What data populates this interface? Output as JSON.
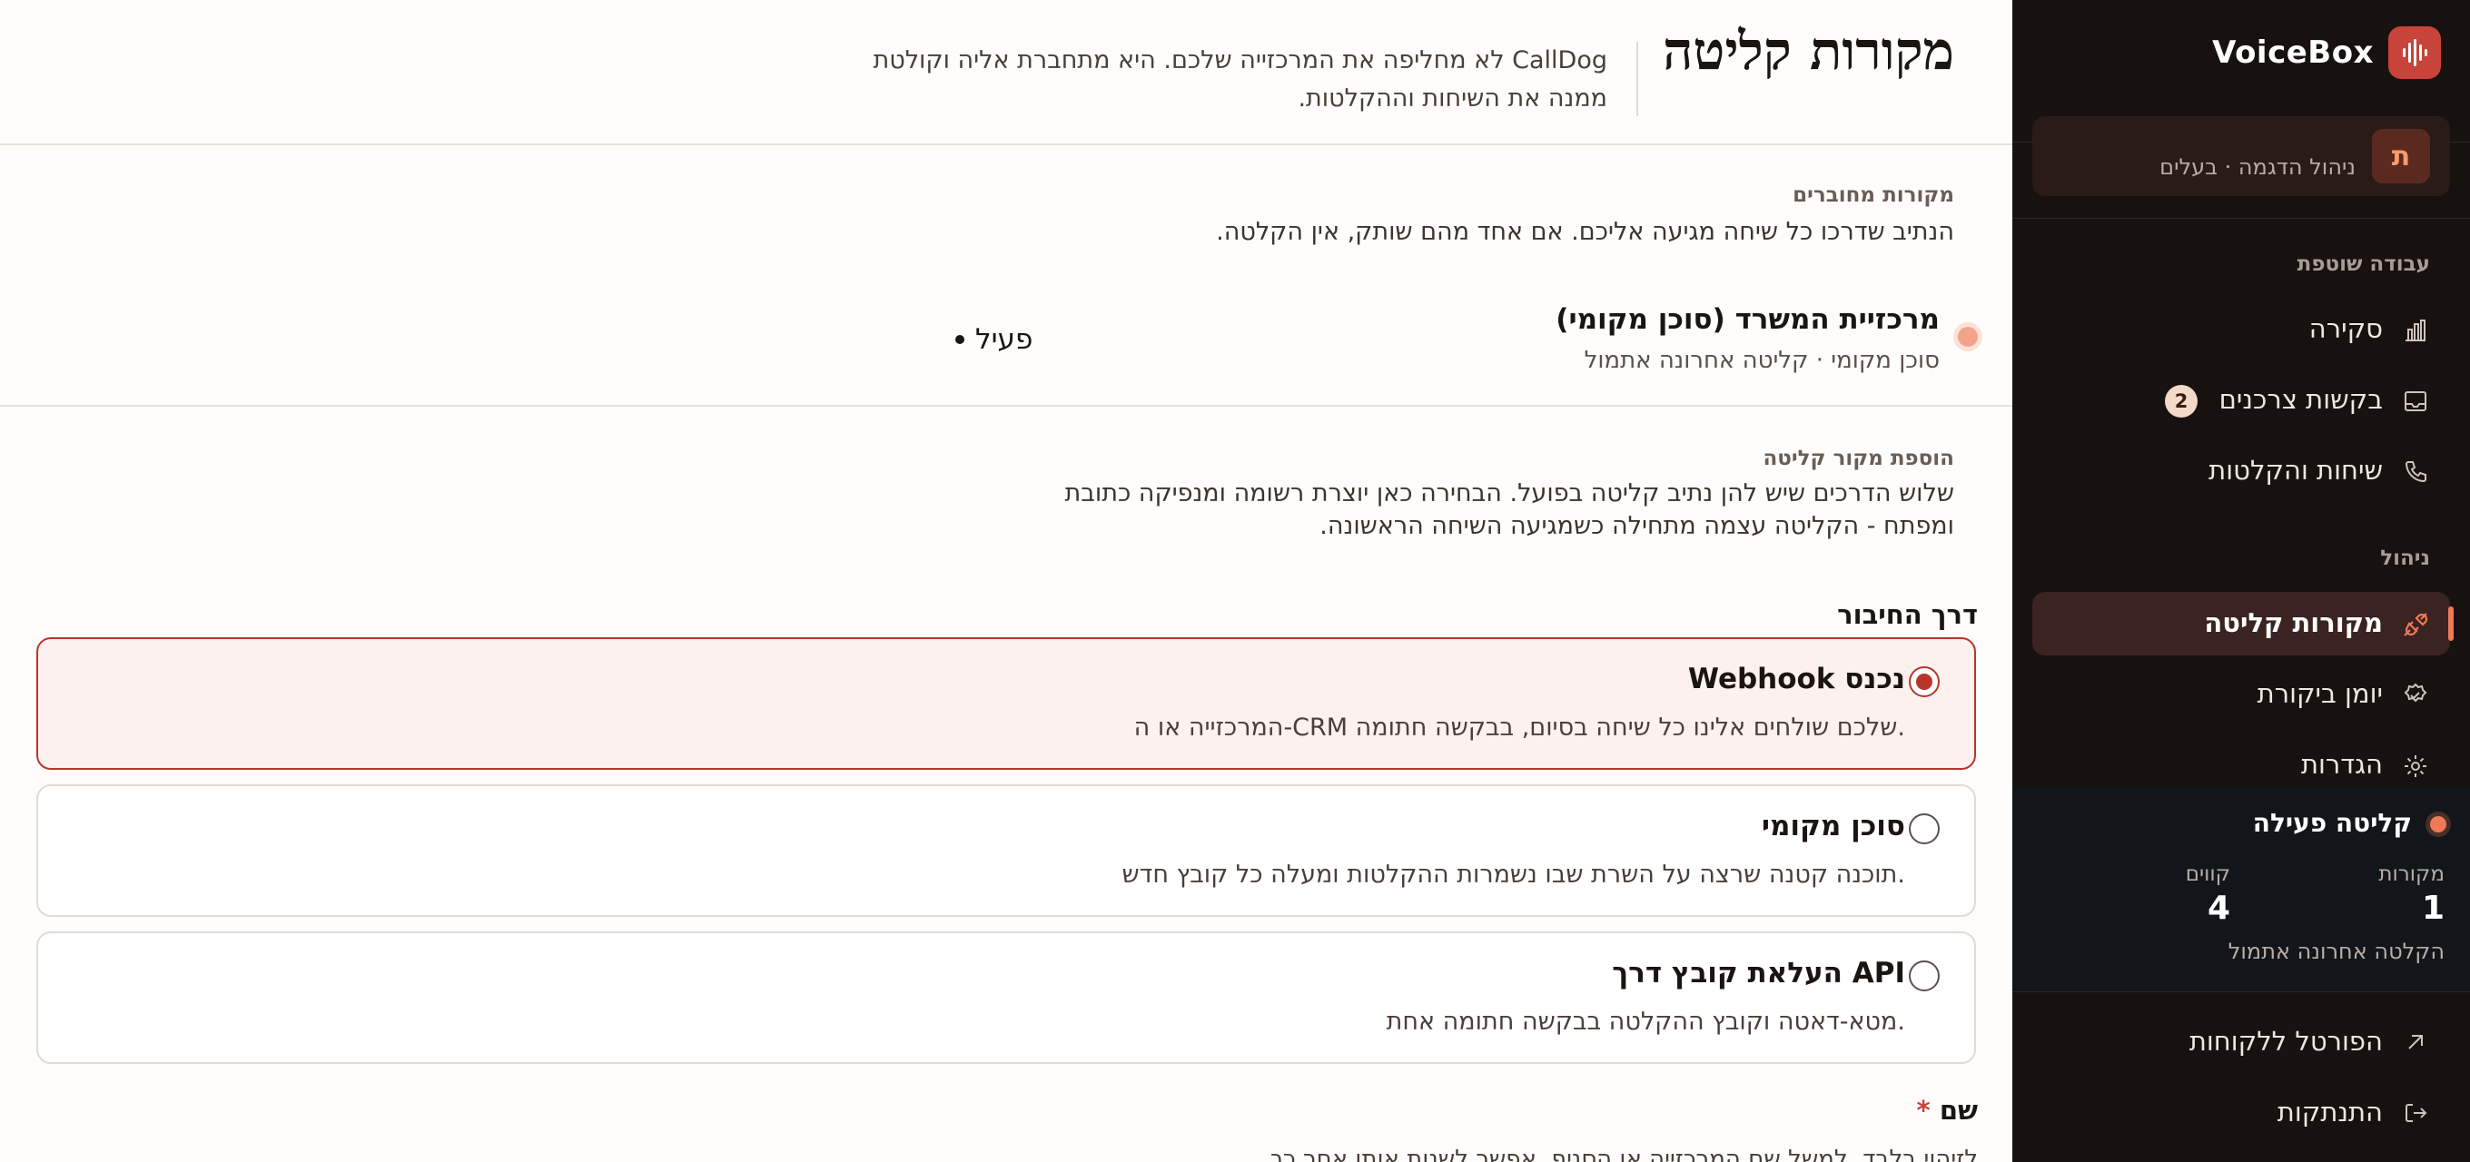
{
  "brand": {
    "name": "VoiceBox"
  },
  "org": {
    "avatar_letter": "ת",
    "subtitle": "ניהול הדגמה · בעלים"
  },
  "sidebar": {
    "sections": [
      {
        "label": "עבודה שוטפת"
      },
      {
        "label": "ניהול"
      }
    ],
    "items": [
      {
        "label": "סקירה",
        "icon": "bar-chart-icon"
      },
      {
        "label": "בקשות צרכנים",
        "icon": "inbox-icon",
        "badge": "2"
      },
      {
        "label": "שיחות והקלטות",
        "icon": "phone-icon"
      },
      {
        "label": "מקורות קליטה",
        "icon": "plug-icon",
        "active": true
      },
      {
        "label": "יומן ביקורת",
        "icon": "shield-check-icon"
      },
      {
        "label": "הגדרות",
        "icon": "gear-icon"
      }
    ],
    "status": {
      "title": "קליטה פעילה",
      "sources_label": "מקורות",
      "sources_value": "1",
      "lines_label": "קווים",
      "lines_value": "4",
      "last": "הקלטה אחרונה אתמול"
    },
    "bottom": [
      {
        "label": "הפורטל ללקוחות",
        "icon": "external-link-icon"
      },
      {
        "label": "התנתקות",
        "icon": "logout-icon"
      }
    ]
  },
  "header": {
    "title": "מקורות קליטה",
    "description": "CallDog לא מחליפה את המרכזייה שלכם. היא מתחברת אליה וקולטת ממנה את השיחות וההקלטות."
  },
  "connected": {
    "kicker": "מקורות מחוברים",
    "description": "הנתיב שדרכו כל שיחה מגיעה אליכם. אם אחד מהם שותק, אין הקלטה.",
    "sources": [
      {
        "name": "מרכזיית המשרד (סוכן מקומי)",
        "meta": "סוכן מקומי · קליטה אחרונה אתמול",
        "status": "פעיל"
      }
    ]
  },
  "add_source": {
    "kicker": "הוספת מקור קליטה",
    "description": "שלוש הדרכים שיש להן נתיב קליטה בפועל. הבחירה כאן יוצרת רשומה ומנפיקה כתובת ומפתח - הקליטה עצמה מתחילה כשמגיעה השיחה הראשונה.",
    "group_label": "דרך החיבור",
    "options": [
      {
        "title": "Webhook נכנס",
        "desc": "המרכזייה או ה-CRM שלכם שולחים אלינו כל שיחה בסיום, בבקשה חתומה.",
        "selected": true
      },
      {
        "title": "סוכן מקומי",
        "desc": "תוכנה קטנה שרצה על השרת שבו נשמרות ההקלטות ומעלה כל קובץ חדש.",
        "selected": false
      },
      {
        "title": "העלאת קובץ דרך API",
        "desc": "מטא-דאטה וקובץ ההקלטה בבקשה חתומה אחת.",
        "selected": false
      }
    ],
    "name_field": {
      "label": "שם",
      "required_mark": "*",
      "help": "לזיהוי בלבד, למשל שם המרכזייה או הסניף. אפשר לשנות אותו אחר כך."
    }
  },
  "colors": {
    "accent": "#c8433a",
    "sidebar_bg": "#171210",
    "active_dot": "#f07a55"
  }
}
